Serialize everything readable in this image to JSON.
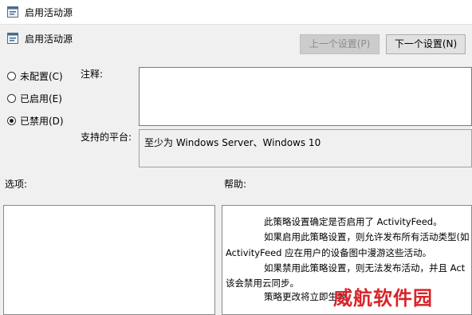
{
  "window": {
    "title": "启用活动源",
    "icon": "policy-icon"
  },
  "header": {
    "title": "启用活动源",
    "icon": "policy-settings-icon"
  },
  "nav": {
    "prev_label": "上一个设置(P)",
    "next_label": "下一个设置(N)"
  },
  "options": [
    {
      "label": "未配置(C)",
      "checked": false
    },
    {
      "label": "已启用(E)",
      "checked": false
    },
    {
      "label": "已禁用(D)",
      "checked": true
    }
  ],
  "comment": {
    "label": "注释:",
    "value": ""
  },
  "platform": {
    "label": "支持的平台:",
    "value": "至少为 Windows Server、Windows 10"
  },
  "sections": {
    "options_label": "选项:",
    "help_label": "帮助:"
  },
  "help": {
    "lines": [
      "此策略设置确定是否启用了 ActivityFeed。",
      "如果启用此策略设置，则允许发布所有活动类型(如",
      "ActivityFeed 应在用户的设备图中漫游这些活动。",
      "如果禁用此策略设置，则无法发布活动，并且 Act",
      "该会禁用云同步。",
      "策略更改将立即生效。"
    ]
  },
  "watermark": {
    "text": "威航软件园"
  }
}
